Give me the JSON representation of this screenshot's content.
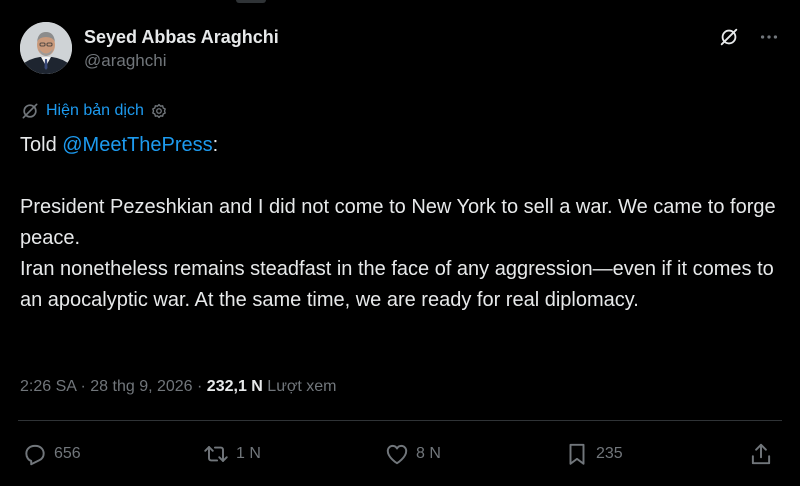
{
  "author": {
    "display_name": "Seyed Abbas Araghchi",
    "handle": "@araghchi"
  },
  "translate": {
    "label": "Hiện bản dịch"
  },
  "tweet": {
    "prefix": "Told ",
    "mention": "@MeetThePress",
    "suffix": ":",
    "paragraph1": "President Pezeshkian and I did not come to New York to sell a war. We came to forge peace.",
    "paragraph2": "Iran nonetheless remains steadfast in the face of any aggression—even if it comes to an apocalyptic war. At the same time, we are ready for real diplomacy."
  },
  "meta": {
    "time": "2:26 SA",
    "sep1": " · ",
    "date": "28 thg 9, 2026",
    "sep2": " · ",
    "views_count": "232,1 N",
    "views_label": " Lượt xem"
  },
  "actions": {
    "replies": "656",
    "reposts": "1 N",
    "likes": "8 N",
    "bookmarks": "235"
  },
  "icons": {
    "grok": "grok-icon",
    "more": "more-icon",
    "translate": "translate-icon",
    "settings": "gear-icon",
    "reply": "reply-icon",
    "repost": "repost-icon",
    "like": "heart-icon",
    "bookmark": "bookmark-icon",
    "share": "share-icon"
  },
  "colors": {
    "background": "#000000",
    "text": "#e7e9ea",
    "secondary": "#71767b",
    "link": "#1d9bf0",
    "divider": "#2f3336"
  }
}
